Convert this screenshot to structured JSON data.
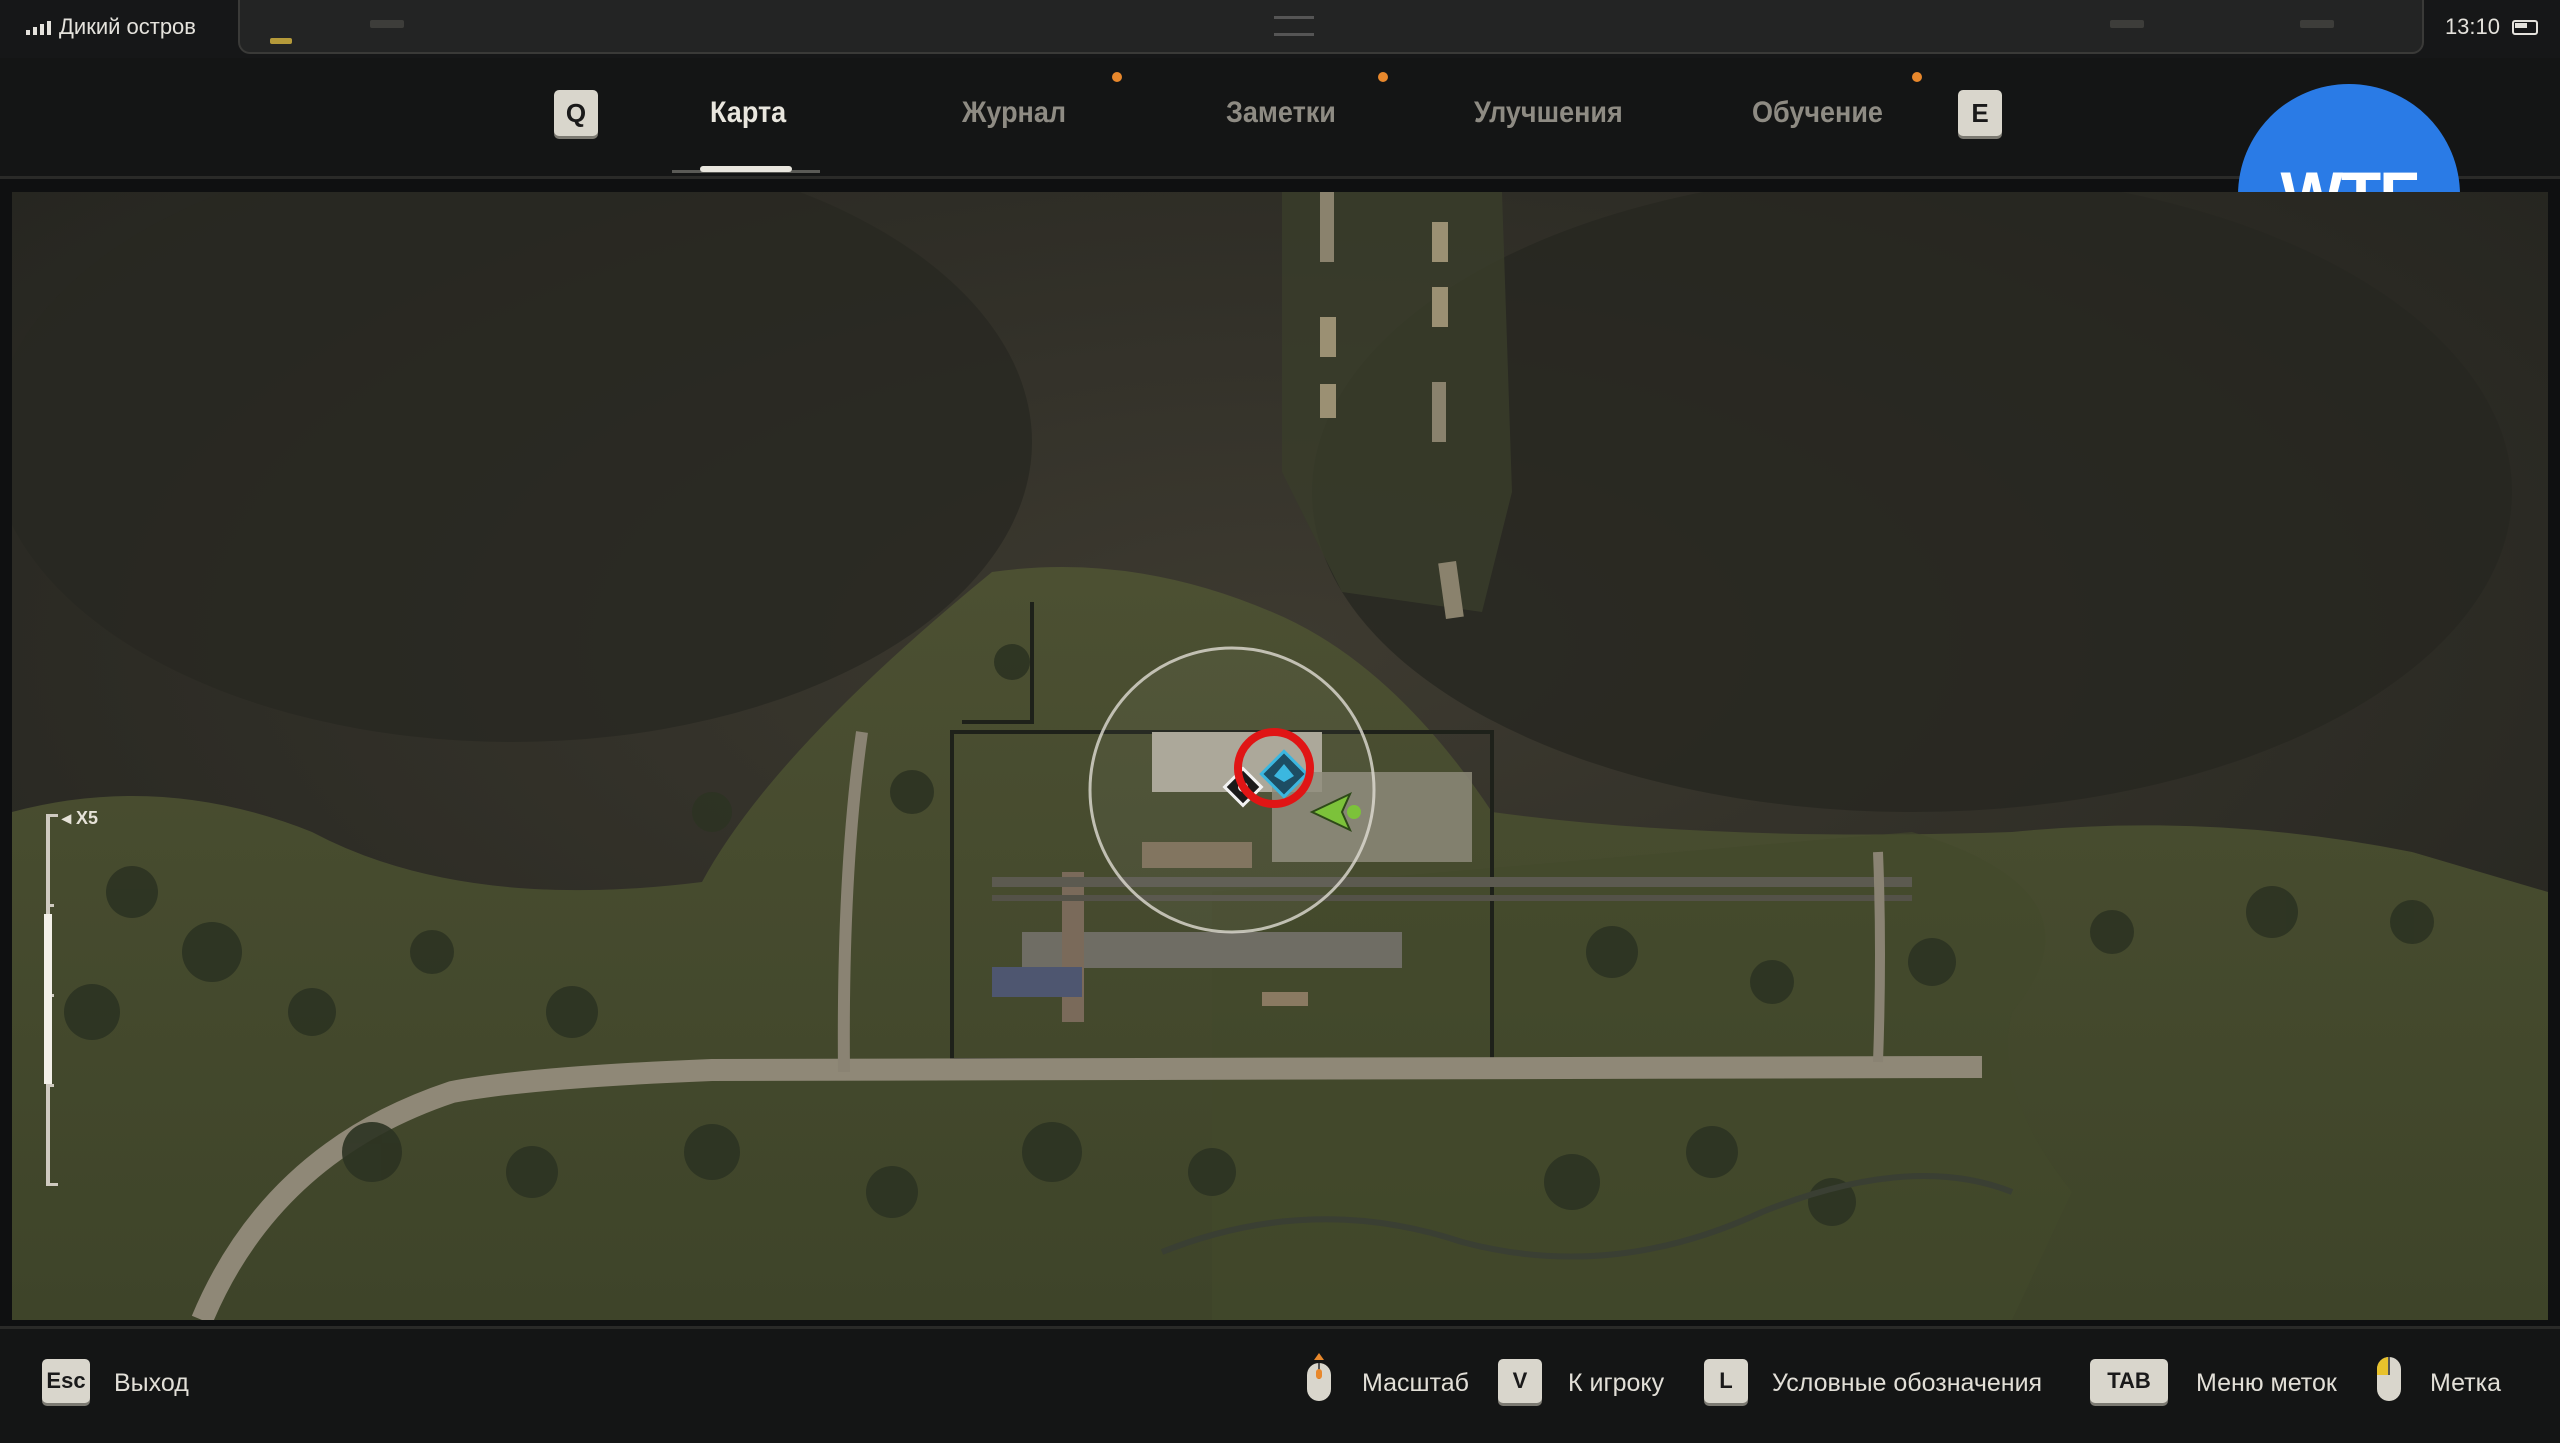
{
  "status": {
    "location": "Дикий остров",
    "time": "13:10"
  },
  "tabs": {
    "prev_key": "Q",
    "next_key": "E",
    "items": [
      {
        "label": "Карта",
        "active": true,
        "notify": false
      },
      {
        "label": "Журнал",
        "active": false,
        "notify": true
      },
      {
        "label": "Заметки",
        "active": false,
        "notify": true
      },
      {
        "label": "Улучшения",
        "active": false,
        "notify": false
      },
      {
        "label": "Обучение",
        "active": false,
        "notify": true
      }
    ]
  },
  "badge": {
    "text": "WTF",
    "color": "#2a7be6"
  },
  "map": {
    "zoom_label": "X5",
    "player_marker_color": "#7cc23a",
    "highlight_ring_color": "#e01515",
    "quest_marker_color": "#3bb7e0"
  },
  "bottom": {
    "exit_key": "Esc",
    "exit_label": "Выход",
    "zoom_label": "Масштаб",
    "to_player_key": "V",
    "to_player_label": "К игроку",
    "legend_key": "L",
    "legend_label": "Условные обозначения",
    "marks_menu_key": "TAB",
    "marks_menu_label": "Меню меток",
    "mark_label": "Метка"
  },
  "colors": {
    "accent_dot": "#e8882c",
    "bar_bg": "#141515"
  }
}
